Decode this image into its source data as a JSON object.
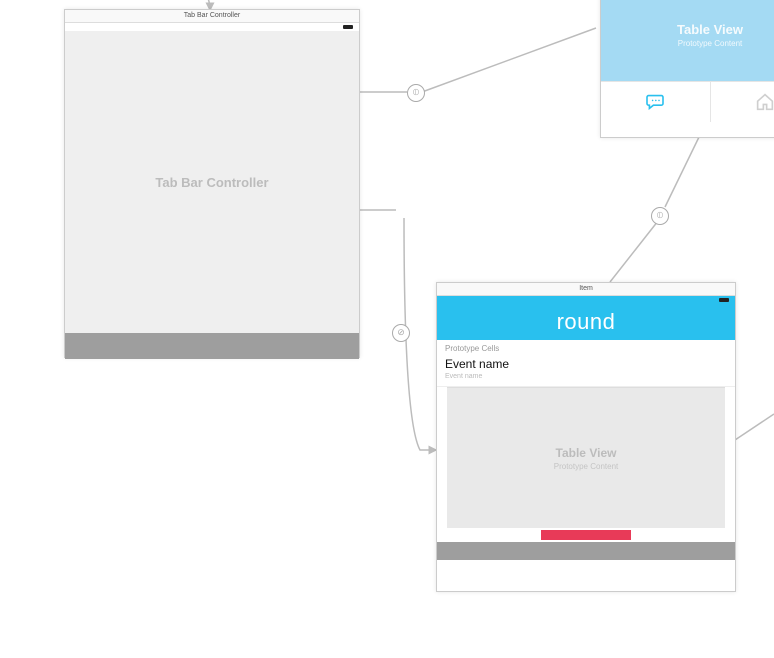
{
  "scene1": {
    "title": "Tab Bar Controller",
    "placeholder": "Tab Bar Controller"
  },
  "scene2": {
    "title": "Item",
    "nav_title": "round",
    "proto_header": "Prototype Cells",
    "cell_title": "Event name",
    "cell_subtitle": "Event name",
    "tv_label": "Table View",
    "tv_sub": "Prototype Content"
  },
  "scene3": {
    "tv_label": "Table View",
    "tv_sub": "Prototype Content"
  },
  "icons": {
    "chat": "chat-icon",
    "home": "home-icon"
  },
  "colors": {
    "accent": "#29c0ee",
    "danger": "#e83a58"
  },
  "segues": {
    "s1_right": "⦶",
    "s2_left": "⊘",
    "s3_bottom": "⦶"
  }
}
